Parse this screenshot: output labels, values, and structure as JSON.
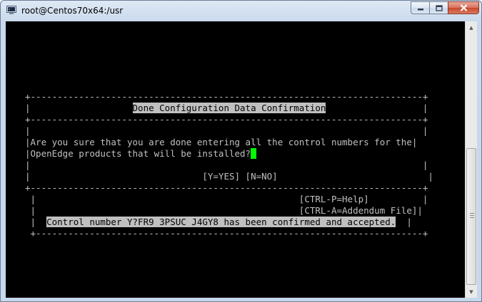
{
  "window": {
    "title": "root@Centos70x64:/usr",
    "icons": {
      "app": "putty-icon",
      "minimize": "minimize-icon",
      "maximize": "maximize-icon",
      "close": "close-icon"
    }
  },
  "dialog": {
    "top_border": "+-------------------------------------------------------------------------+",
    "blank_row": "|                                                                         |",
    "title_prefix": "|                   ",
    "title": "Done Configuration Data Confirmation",
    "title_suffix": "                  |",
    "separator": "+-------------------------------------------------------------------------+",
    "message_line1": "|Are you sure that you are done entering all the control numbers for the|",
    "message_line2_prefix": "|",
    "message_line2": "OpenEdge products that will be installed?",
    "options_row": "|                                [Y=YES] [N=NO]                            |",
    "bottom_border": "+-------------------------------------------------------------------------+"
  },
  "status_panel": {
    "blank_row": " |                                                                        |",
    "help_row": " |                                                 [CTRL-P=Help]          |",
    "addendum_row": " |                                                 [CTRL-A=Addendum File]|",
    "message_prefix": " |  ",
    "message": "Control number Y?FR9 3PSUC J4GY8 has been confirmed and accepted.",
    "message_suffix": "  |",
    "bottom_border": " +------------------------------------------------------------------------+"
  },
  "colors": {
    "terminal_bg": "#000000",
    "terminal_fg": "#c0c0c0",
    "cursor": "#00ff00"
  }
}
